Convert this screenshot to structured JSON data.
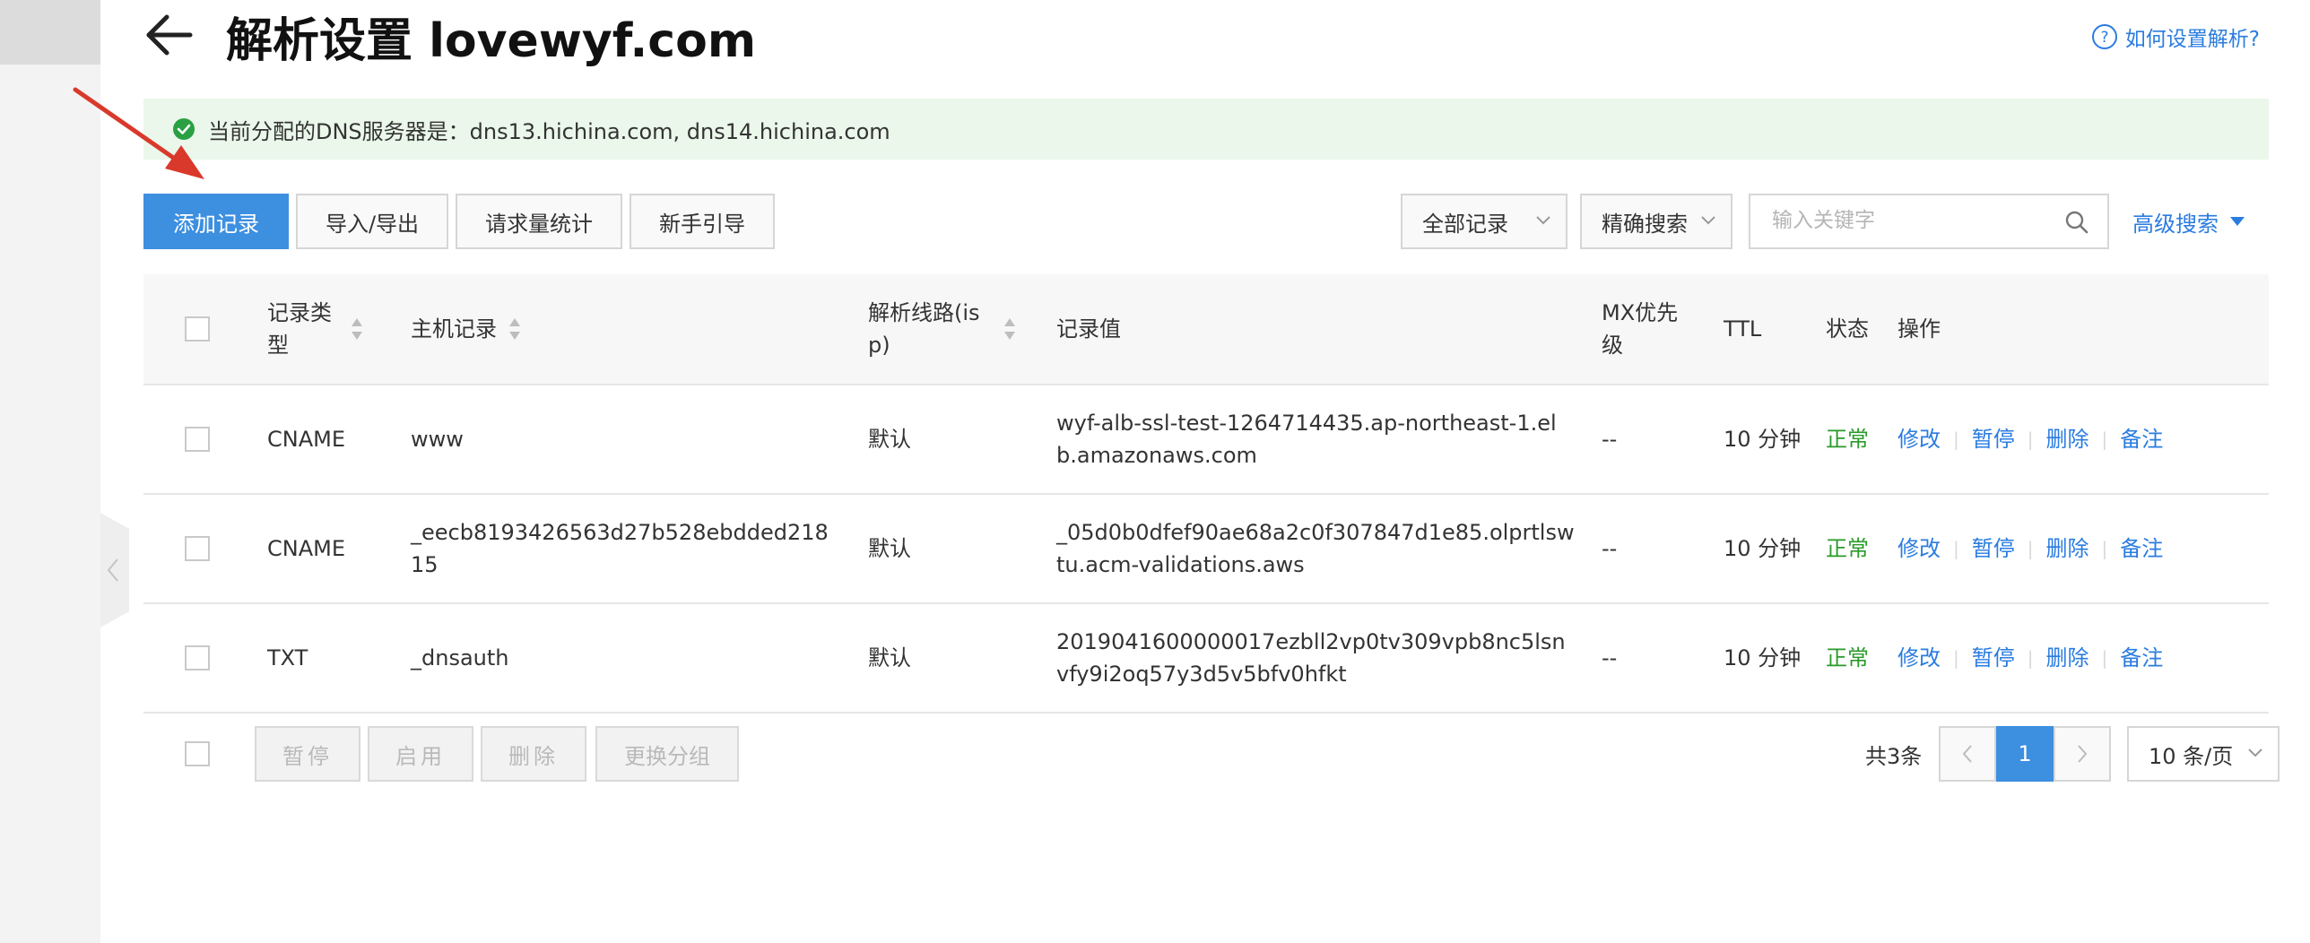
{
  "header": {
    "title": "解析设置 lovewyf.com",
    "help_link": "如何设置解析?"
  },
  "banner": {
    "text": "当前分配的DNS服务器是：dns13.hichina.com, dns14.hichina.com"
  },
  "toolbar": {
    "buttons": [
      "添加记录",
      "导入/导出",
      "请求量统计",
      "新手引导"
    ],
    "filter_select": "全部记录",
    "search_mode_select": "精确搜索",
    "search_placeholder": "输入关键字",
    "advanced_search": "高级搜索"
  },
  "table": {
    "columns": [
      "记录类型",
      "主机记录",
      "解析线路(isp)",
      "记录值",
      "MX优先级",
      "TTL",
      "状态",
      "操作"
    ],
    "rows": [
      {
        "type": "CNAME",
        "host": "www",
        "line": "默认",
        "value": "wyf-alb-ssl-test-1264714435.ap-northeast-1.elb.amazonaws.com",
        "mx": "--",
        "ttl": "10 分钟",
        "status": "正常"
      },
      {
        "type": "CNAME",
        "host": "_eecb8193426563d27b528ebdded21815",
        "line": "默认",
        "value": "_05d0b0dfef90ae68a2c0f307847d1e85.olprtlswtu.acm-validations.aws",
        "mx": "--",
        "ttl": "10 分钟",
        "status": "正常"
      },
      {
        "type": "TXT",
        "host": "_dnsauth",
        "line": "默认",
        "value": "2019041600000017ezbll2vp0tv309vpb8nc5lsnvfy9i2oq57y3d5v5bfv0hfkt",
        "mx": "--",
        "ttl": "10 分钟",
        "status": "正常"
      }
    ],
    "row_actions": [
      "修改",
      "暂停",
      "删除",
      "备注"
    ]
  },
  "footer": {
    "batch_buttons": [
      "暂停",
      "启用",
      "删除",
      "更换分组"
    ],
    "total": "共3条",
    "current_page": "1",
    "page_size": "10 条/页"
  },
  "colors": {
    "primary": "#3d8fe0",
    "link": "#2a7ce0",
    "status_ok": "#2a9a2a",
    "banner_bg": "#eaf7ea",
    "annotation_arrow": "#d9392b"
  },
  "icons": [
    "back-arrow-icon",
    "help-circle-icon",
    "check-circle-icon",
    "chevron-down-icon",
    "search-icon",
    "caret-down-icon",
    "sort-icon",
    "chevron-left-icon",
    "chevron-right-icon",
    "annotation-arrow-icon"
  ]
}
